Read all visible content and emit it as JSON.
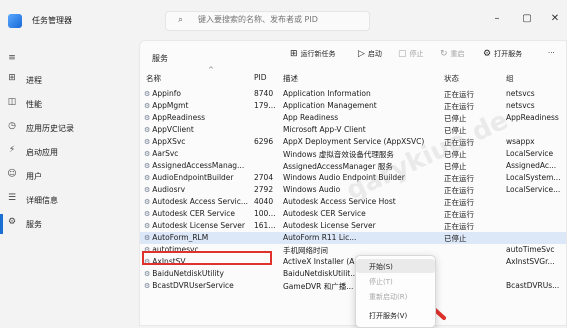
{
  "app": {
    "title": "任务管理器"
  },
  "search": {
    "placeholder": "键入要搜索的名称、发布者或 PID"
  },
  "window": {
    "minimize": "–",
    "maximize": "▢",
    "close": "✕"
  },
  "nav": [
    {
      "label": "",
      "icon": "hamburger-icon",
      "glyph": "≡"
    },
    {
      "label": "进程",
      "icon": "processes-icon",
      "glyph": "⊞"
    },
    {
      "label": "性能",
      "icon": "performance-icon",
      "glyph": "◫"
    },
    {
      "label": "应用历史记录",
      "icon": "history-icon",
      "glyph": "◷"
    },
    {
      "label": "启动应用",
      "icon": "startup-icon",
      "glyph": "⚡"
    },
    {
      "label": "用户",
      "icon": "users-icon",
      "glyph": "☺"
    },
    {
      "label": "详细信息",
      "icon": "details-icon",
      "glyph": "☰"
    },
    {
      "label": "服务",
      "icon": "services-icon",
      "glyph": "⚙"
    }
  ],
  "main": {
    "title": "服务"
  },
  "toolbar": {
    "new_task": "运行新任务",
    "start": "启动",
    "stop": "停止",
    "restart": "重启",
    "open_services": "打开服务",
    "more": "···"
  },
  "columns": {
    "name": "名称",
    "pid": "PID",
    "desc": "描述",
    "status": "状态",
    "group": "组"
  },
  "rows": [
    {
      "name": "Appinfo",
      "pid": "8740",
      "desc": "Application Information",
      "status": "正在运行",
      "group": "netsvcs"
    },
    {
      "name": "AppMgmt",
      "pid": "179...",
      "desc": "Application Management",
      "status": "正在运行",
      "group": "netsvcs"
    },
    {
      "name": "AppReadiness",
      "pid": "",
      "desc": "App Readiness",
      "status": "已停止",
      "group": "AppReadiness"
    },
    {
      "name": "AppVClient",
      "pid": "",
      "desc": "Microsoft App-V Client",
      "status": "已停止",
      "group": ""
    },
    {
      "name": "AppXSvc",
      "pid": "6296",
      "desc": "AppX Deployment Service (AppXSVC)",
      "status": "正在运行",
      "group": "wsappx"
    },
    {
      "name": "AarSvc",
      "pid": "",
      "desc": "Windows 虚拟音效设备代理服务",
      "status": "已停止",
      "group": "LocalService"
    },
    {
      "name": "AssignedAccessManag...",
      "pid": "",
      "desc": "AssignedAccessManager 服务",
      "status": "已停止",
      "group": "AssignedAc..."
    },
    {
      "name": "AudioEndpointBuilder",
      "pid": "2704",
      "desc": "Windows Audio Endpoint Builder",
      "status": "正在运行",
      "group": "LocalSystem..."
    },
    {
      "name": "Audiosrv",
      "pid": "2792",
      "desc": "Windows Audio",
      "status": "正在运行",
      "group": "LocalService..."
    },
    {
      "name": "Autodesk Access Servic...",
      "pid": "4040",
      "desc": "Autodesk Access Service Host",
      "status": "正在运行",
      "group": ""
    },
    {
      "name": "Autodesk CER Service",
      "pid": "100...",
      "desc": "Autodesk CER Service",
      "status": "正在运行",
      "group": ""
    },
    {
      "name": "Autodesk License Server",
      "pid": "161...",
      "desc": "Autodesk License Server",
      "status": "正在运行",
      "group": ""
    },
    {
      "name": "AutoForm_RLM",
      "pid": "",
      "desc": "AutoForm R11 Lic...",
      "status": "已停止",
      "group": ""
    },
    {
      "name": "autotimesvc",
      "pid": "",
      "desc": "手机网络时间",
      "status": "",
      "group": "autoTimeSvc"
    },
    {
      "name": "AxInstSV",
      "pid": "",
      "desc": "ActiveX Installer (A...",
      "status": "",
      "group": "AxInstSVGr..."
    },
    {
      "name": "BaiduNetdiskUtility",
      "pid": "",
      "desc": "BaiduNetdiskUtilit...",
      "status": "",
      "group": ""
    },
    {
      "name": "BcastDVRUserService",
      "pid": "",
      "desc": "GameDVR 和广播...",
      "status": "",
      "group": "BcastDVRUs..."
    }
  ],
  "context_menu": [
    {
      "label": "开始(S)",
      "enabled": true
    },
    {
      "label": "停止(T)",
      "enabled": false
    },
    {
      "label": "重新启动(R)",
      "enabled": false
    },
    {
      "label": "打开服务(V)",
      "enabled": true
    }
  ],
  "watermark": "garykiuo.de",
  "colors": {
    "accent": "#1a6fd3",
    "highlight_box": "#e0322c",
    "selected_row": "#dce7f7"
  }
}
